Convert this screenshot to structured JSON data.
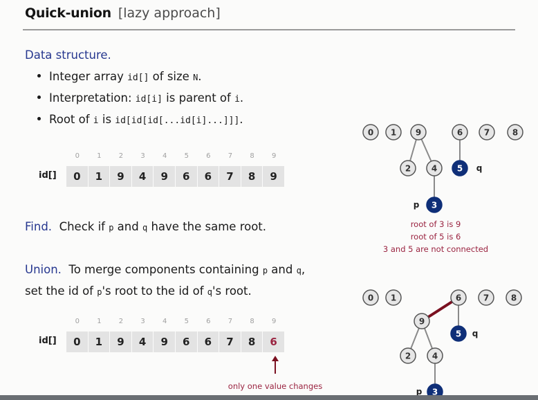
{
  "title": {
    "main": "Quick-union",
    "sub": "[lazy approach]"
  },
  "data_structure": {
    "heading": "Data structure.",
    "bullets": [
      {
        "parts": [
          "Integer array ",
          "id[]",
          " of size ",
          "N",
          "."
        ]
      },
      {
        "parts": [
          "Interpretation:  ",
          "id[i]",
          " is parent of ",
          "i",
          "."
        ]
      },
      {
        "parts": [
          "Root of ",
          "i",
          " is ",
          "id[id[id[...id[i]...]]]",
          "."
        ]
      }
    ]
  },
  "array_before": {
    "label": "id[]",
    "indices": [
      "0",
      "1",
      "2",
      "3",
      "4",
      "5",
      "6",
      "7",
      "8",
      "9"
    ],
    "values": [
      "0",
      "1",
      "9",
      "4",
      "9",
      "6",
      "6",
      "7",
      "8",
      "9"
    ]
  },
  "find": {
    "heading": "Find.",
    "parts": [
      "Check if ",
      "p",
      " and ",
      "q",
      " have the same root."
    ]
  },
  "union": {
    "heading": "Union.",
    "line1": [
      "To merge components containing ",
      "p",
      " and ",
      "q",
      ","
    ],
    "line2": [
      "set the id of ",
      "p",
      "'s root to the id of ",
      "q",
      "'s root."
    ]
  },
  "array_after": {
    "label": "id[]",
    "indices": [
      "0",
      "1",
      "2",
      "3",
      "4",
      "5",
      "6",
      "7",
      "8",
      "9"
    ],
    "values": [
      "0",
      "1",
      "9",
      "4",
      "9",
      "6",
      "6",
      "7",
      "8",
      "6"
    ],
    "changed_index": 9,
    "annotation": "only one value changes"
  },
  "tree_before": {
    "nodes": [
      {
        "id": "0",
        "highlight": false
      },
      {
        "id": "1",
        "highlight": false
      },
      {
        "id": "9",
        "highlight": false
      },
      {
        "id": "6",
        "highlight": false
      },
      {
        "id": "7",
        "highlight": false
      },
      {
        "id": "8",
        "highlight": false
      },
      {
        "id": "2",
        "highlight": false
      },
      {
        "id": "4",
        "highlight": false
      },
      {
        "id": "5",
        "highlight": true
      },
      {
        "id": "3",
        "highlight": true
      }
    ],
    "edges": [
      [
        "9",
        "2"
      ],
      [
        "9",
        "4"
      ],
      [
        "6",
        "5"
      ],
      [
        "4",
        "3"
      ]
    ],
    "labels": {
      "p": "p",
      "q": "q"
    },
    "notes": [
      "root of 3 is 9",
      "root of 5 is 6",
      "3 and 5 are not connected"
    ]
  },
  "tree_after": {
    "edges": [
      [
        "9",
        "2"
      ],
      [
        "9",
        "4"
      ],
      [
        "6",
        "5"
      ],
      [
        "4",
        "3"
      ],
      [
        "6",
        "9"
      ]
    ],
    "new_edge": [
      "6",
      "9"
    ],
    "labels": {
      "p": "p",
      "q": "q"
    }
  },
  "colors": {
    "heading_blue": "#26378f",
    "highlight_node": "#0f2f78",
    "node_fill": "#e6e6e6",
    "accent_red": "#9a2340",
    "new_edge": "#7a1020"
  }
}
